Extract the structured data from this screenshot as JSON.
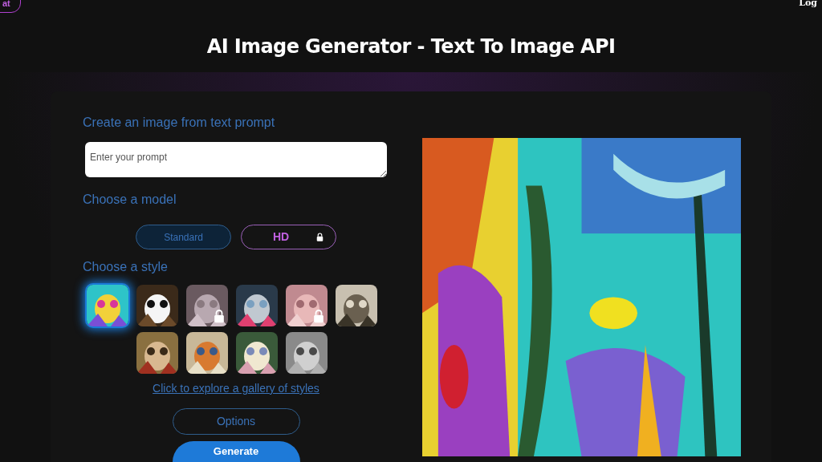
{
  "header": {
    "left_button": "at",
    "right_link": "Log"
  },
  "title": "AI Image Generator - Text To Image API",
  "form": {
    "prompt_heading": "Create an image from text prompt",
    "prompt": {
      "placeholder": "Enter your prompt"
    },
    "model_heading": "Choose a model",
    "models": [
      {
        "label": "Standard",
        "selected": true,
        "locked": false
      },
      {
        "label": "HD",
        "selected": false,
        "locked": true
      }
    ],
    "style_heading": "Choose a style",
    "styles": [
      {
        "selected": true,
        "locked": false
      },
      {
        "selected": false,
        "locked": false
      },
      {
        "selected": false,
        "locked": true
      },
      {
        "selected": false,
        "locked": false
      },
      {
        "selected": false,
        "locked": true
      },
      {
        "selected": false,
        "locked": false
      },
      {
        "selected": false,
        "locked": false
      },
      {
        "selected": false,
        "locked": false
      },
      {
        "selected": false,
        "locked": false
      },
      {
        "selected": false,
        "locked": false
      }
    ],
    "gallery_link": "Click to explore a gallery of styles",
    "options_button": "Options",
    "generate_button": "Generate"
  }
}
